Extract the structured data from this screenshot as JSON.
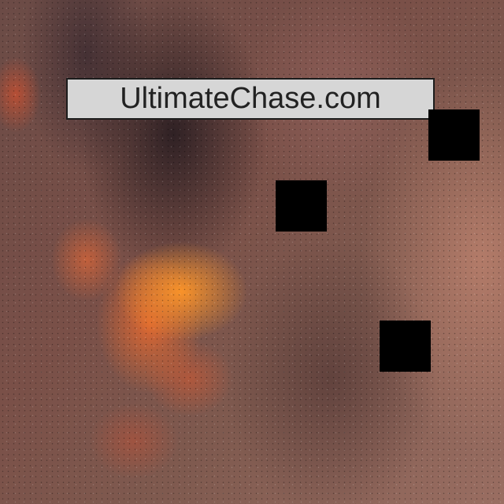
{
  "image": {
    "description_tags": [
      "fire",
      "smoke",
      "blurred",
      "occlusion-squares"
    ]
  },
  "watermark": {
    "text": "UltimateChase.com"
  },
  "occlusions": {
    "color": "#000000",
    "count": 3
  },
  "palette": {
    "fire": "#ff8a28",
    "smoke": "#231a1e",
    "background": "#7a5048"
  }
}
